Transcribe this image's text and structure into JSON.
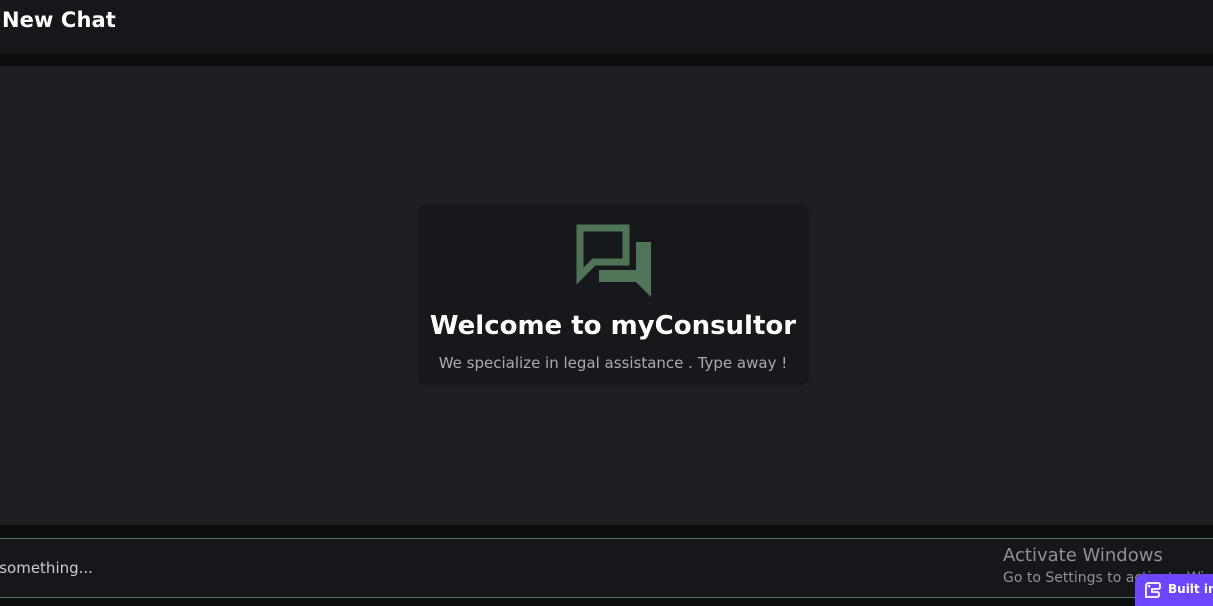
{
  "header": {
    "title": "New Chat"
  },
  "welcome": {
    "icon": "chat-bubbles-icon",
    "title": "Welcome to myConsultor",
    "subtitle": "We specialize in legal assistance . Type away !"
  },
  "composer": {
    "placeholder": "Type something..."
  },
  "overlay": {
    "activate_title": "Activate Windows",
    "activate_subtitle": "Go to Settings to activate Windows.",
    "badge_label": "Built in Rowy"
  },
  "colors": {
    "accent": "#4d7a5a",
    "icon": "#4f7457",
    "badge": "#6c47ff"
  }
}
